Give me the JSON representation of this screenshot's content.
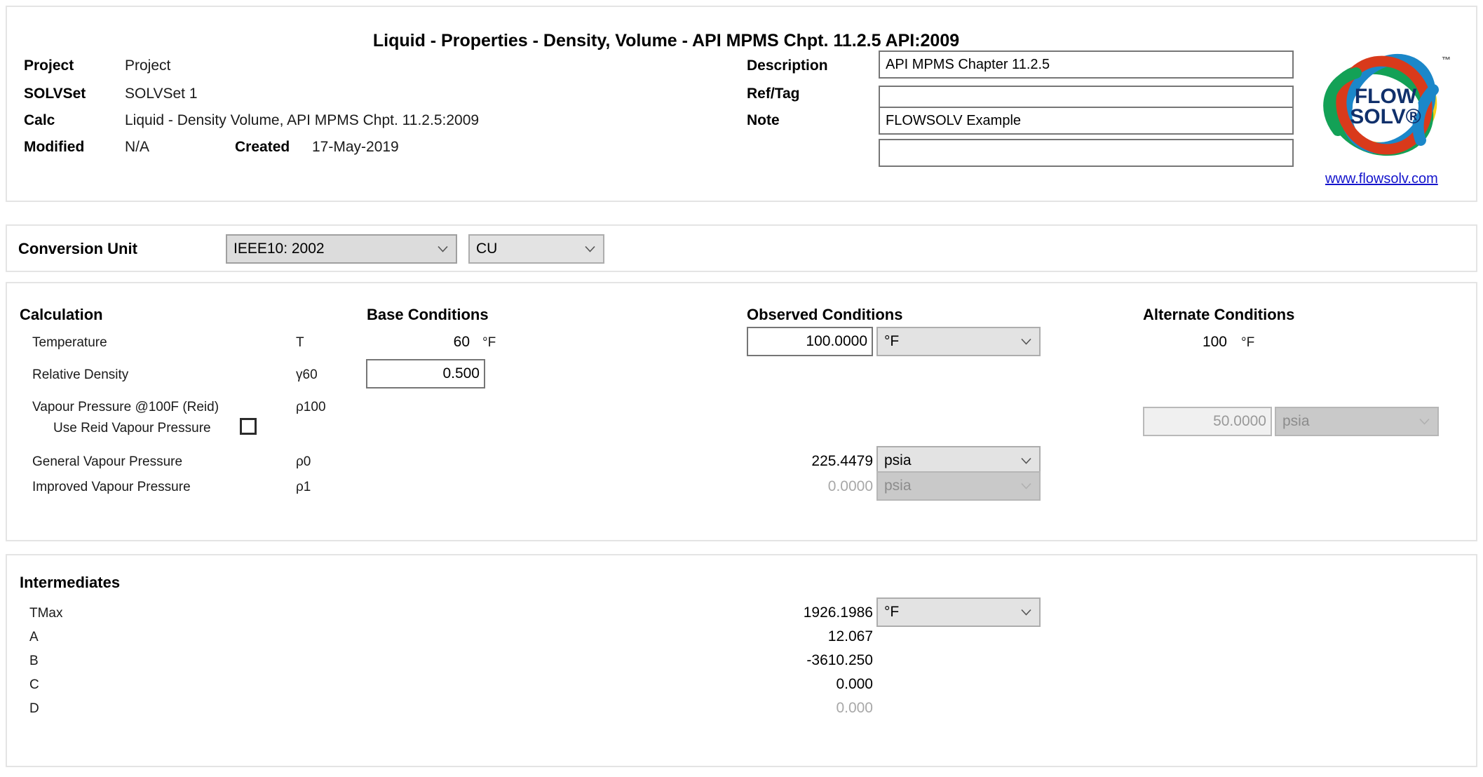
{
  "form_title": "Liquid - Properties - Density, Volume - API MPMS Chpt. 11.2.5 API:2009",
  "header": {
    "labels": {
      "project": "Project",
      "solvset": "SOLVSet",
      "calc": "Calc",
      "modified": "Modified",
      "created": "Created",
      "description": "Description",
      "ref_tag": "Ref/Tag",
      "note": "Note"
    },
    "values": {
      "project": "Project",
      "solvset": "SOLVSet 1",
      "calc": "Liquid - Density Volume, API MPMS Chpt. 11.2.5:2009",
      "modified": "N/A",
      "created": "17-May-2019"
    },
    "inputs": {
      "description": "API MPMS Chapter 11.2.5",
      "ref_tag": "",
      "note": "FLOWSOLV Example",
      "note2": "",
      "placeholder": ""
    }
  },
  "logo": {
    "line1": "FLOW",
    "line2": "SOLV®",
    "tm": "™",
    "url": "www.flowsolv.com",
    "colors": {
      "red": "#d93a1b",
      "blue": "#1b87c9",
      "green": "#13a156",
      "yellow": "#f5d117",
      "text": "#10306b",
      "link": "#1414cc"
    }
  },
  "conversion_unit": {
    "label": "Conversion Unit",
    "standard": "IEEE10: 2002",
    "unit_system": "CU"
  },
  "calculation": {
    "headers": {
      "calculation": "Calculation",
      "base": "Base Conditions",
      "observed": "Observed Conditions",
      "alternate": "Alternate Conditions"
    },
    "rows": [
      {
        "label": "Temperature",
        "symbol": "T",
        "base_value": "60",
        "base_unit": "°F",
        "observed_value": "100.0000",
        "observed_unit": "°F",
        "alternate_value": "100",
        "alternate_unit": "°F"
      },
      {
        "label": "Relative Density",
        "symbol": "γ60",
        "base_value": "0.500"
      },
      {
        "label": "Vapour Pressure @100F (Reid)",
        "symbol": "ρ100",
        "alternate_value": "50.0000",
        "alternate_unit": "psia"
      },
      {
        "label": "Use Reid Vapour Pressure",
        "checked": false
      },
      {
        "label": "General Vapour Pressure",
        "symbol": "ρ0",
        "observed_value": "225.4479",
        "observed_unit": "psia"
      },
      {
        "label": "Improved Vapour Pressure",
        "symbol": "ρ1",
        "observed_value": "0.0000",
        "observed_unit": "psia"
      }
    ]
  },
  "intermediates": {
    "title": "Intermediates",
    "rows": [
      {
        "label": "TMax",
        "value": "1926.1986",
        "unit": "°F"
      },
      {
        "label": "A",
        "value": "12.067"
      },
      {
        "label": "B",
        "value": "-3610.250"
      },
      {
        "label": "C",
        "value": "0.000"
      },
      {
        "label": "D",
        "value": "0.000"
      }
    ]
  }
}
